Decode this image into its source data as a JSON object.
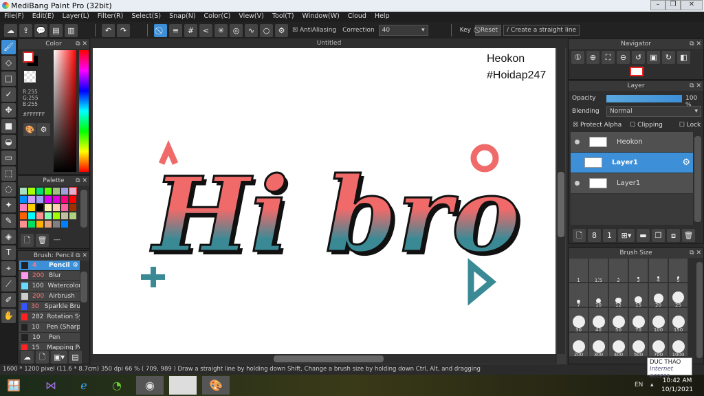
{
  "window": {
    "title": "MediBang Paint Pro (32bit)"
  },
  "menu": [
    "File(F)",
    "Edit(E)",
    "Layer(L)",
    "Filter(R)",
    "Select(S)",
    "Snap(N)",
    "Color(C)",
    "View(V)",
    "Tool(T)",
    "Window(W)",
    "Cloud",
    "Help"
  ],
  "toolbar": {
    "antialiasing_label": "AntiAliasing",
    "antialiasing_checked": true,
    "correction_label": "Correction",
    "correction_value": "40",
    "key_label": "Key",
    "reset_label": "Reset",
    "straight_line_label": "Create a straight line"
  },
  "color_panel": {
    "title": "Color",
    "r": "R:255",
    "g": "G:255",
    "b": "B:255",
    "hex": "#FFFFFF",
    "foreground": "#FFFFFF",
    "background": "#000000"
  },
  "palette_panel": {
    "title": "Palette",
    "footer": "---",
    "colors": [
      "#a8e0c0",
      "#a8ff00",
      "#00e070",
      "#60ff00",
      "#a0c080",
      "#a0a0e0",
      "#e0b0d0",
      "#0090ff",
      "#d0a0ff",
      "#a0a0ff",
      "#e000ff",
      "#e000e0",
      "#ff0080",
      "#ff0000",
      "#ff80c0",
      "#ffd000",
      "#000000",
      "#fff0b0",
      "#ffd0b0",
      "#ff60a0",
      "#a03000",
      "#ff6000",
      "#00ffff",
      "#ff9090",
      "#80ffb0",
      "#a0ff00",
      "#c0c0a0",
      "#b0d080",
      "#ff9090",
      "#00e060",
      "#ffb000",
      "#e0a080",
      "#808080",
      "#0080ff"
    ]
  },
  "brush_panel": {
    "title": "Brush: Pencil",
    "items": [
      {
        "size": "4",
        "name": "Pencil",
        "color": "#222222",
        "selected": true
      },
      {
        "size": "200",
        "name": "Blur",
        "color": "#ff99ee"
      },
      {
        "size": "100",
        "name": "Watercolor",
        "color": "#66ddff"
      },
      {
        "size": "200",
        "name": "Airbrush",
        "color": "#cccccc"
      },
      {
        "size": "30",
        "name": "Sparkle Brush",
        "color": "#3355ff"
      },
      {
        "size": "282",
        "name": "Rotation Sy",
        "color": "#ff2222"
      },
      {
        "size": "10",
        "name": "Pen (Sharp)",
        "color": "#222222"
      },
      {
        "size": "10",
        "name": "Pen",
        "color": "#222222"
      },
      {
        "size": "15",
        "name": "Mapping Pe",
        "color": "#ff2222"
      }
    ]
  },
  "document": {
    "title": "Untitled",
    "watermark_line1": "Heokon",
    "watermark_line2": "#Hoidap247",
    "artwork_text": "Hi bro"
  },
  "navigator": {
    "title": "Navigator"
  },
  "layer_panel": {
    "title": "Layer",
    "opacity_label": "Opacity",
    "opacity_value": "100 %",
    "opacity_percent": 100,
    "blending_label": "Blending",
    "blending_value": "Normal",
    "protect_alpha": "Protect Alpha",
    "protect_alpha_checked": true,
    "clipping": "Clipping",
    "lock": "Lock",
    "layers": [
      {
        "name": "Heokon"
      },
      {
        "name": "Layer1",
        "selected": true
      },
      {
        "name": "Layer1"
      }
    ]
  },
  "brush_size_panel": {
    "title": "Brush Size",
    "sizes": [
      "1",
      "1.5",
      "2",
      "3",
      "4",
      "5",
      "7",
      "10",
      "12",
      "15",
      "20",
      "25",
      "30",
      "40",
      "50",
      "70",
      "100",
      "150",
      "200",
      "300",
      "400",
      "500",
      "700",
      "1000"
    ]
  },
  "status": {
    "text": "1600 * 1200 pixel  (11.6 * 8.7cm)  350 dpi  66 %  ( 709, 989 )  Draw a straight line by holding down Shift, Change a brush size by holding down Ctrl, Alt, and dragging"
  },
  "tooltip": {
    "line1": "DUC THAO",
    "line2": "Internet access"
  },
  "taskbar": {
    "lang": "EN",
    "time": "10:42 AM",
    "date": "10/1/2021"
  },
  "colors": {
    "accent": "#3d8fd8",
    "art_top": "#f06a6a",
    "art_bottom": "#3a8a96"
  }
}
